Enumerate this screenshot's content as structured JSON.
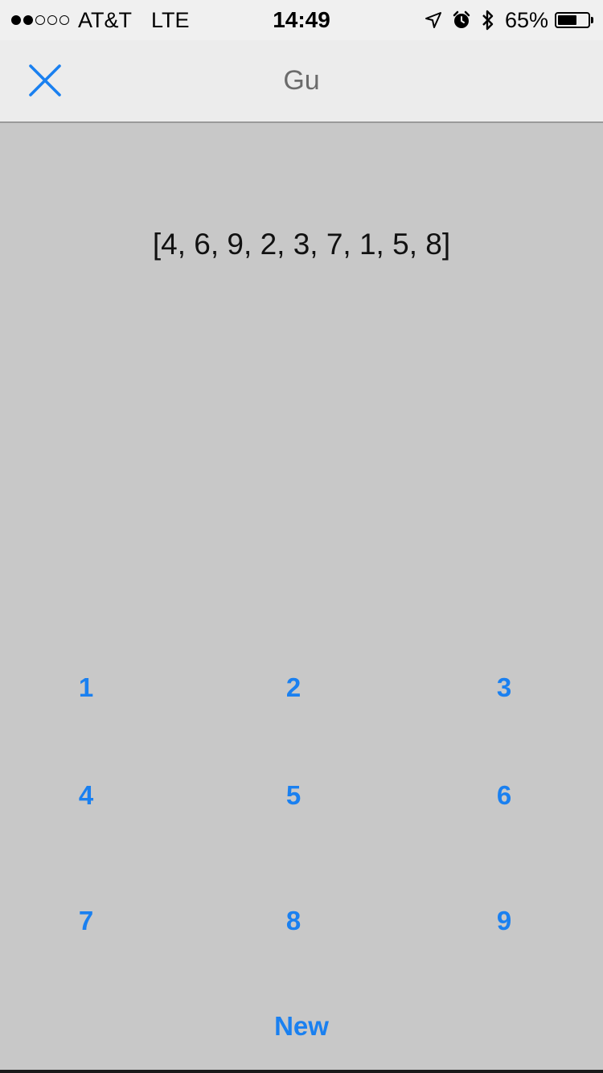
{
  "status_bar": {
    "signal_filled": 2,
    "signal_total": 5,
    "carrier": "AT&T",
    "network": "LTE",
    "time": "14:49",
    "battery_percent_label": "65%",
    "battery_level": 0.65,
    "icons": [
      "location-arrow-icon",
      "alarm-clock-icon",
      "bluetooth-icon",
      "battery-icon"
    ]
  },
  "nav": {
    "title": "Gu",
    "close_icon": "close-icon",
    "accent_color": "#1a80f0"
  },
  "content": {
    "array_text": "[4, 6, 9, 2, 3, 7, 1, 5, 8]"
  },
  "keypad": {
    "keys": [
      "1",
      "2",
      "3",
      "4",
      "5",
      "6",
      "7",
      "8",
      "9"
    ],
    "new_label": "New"
  },
  "colors": {
    "background": "#c8c8c8",
    "nav_background": "#ececec",
    "accent": "#1a80f0"
  }
}
